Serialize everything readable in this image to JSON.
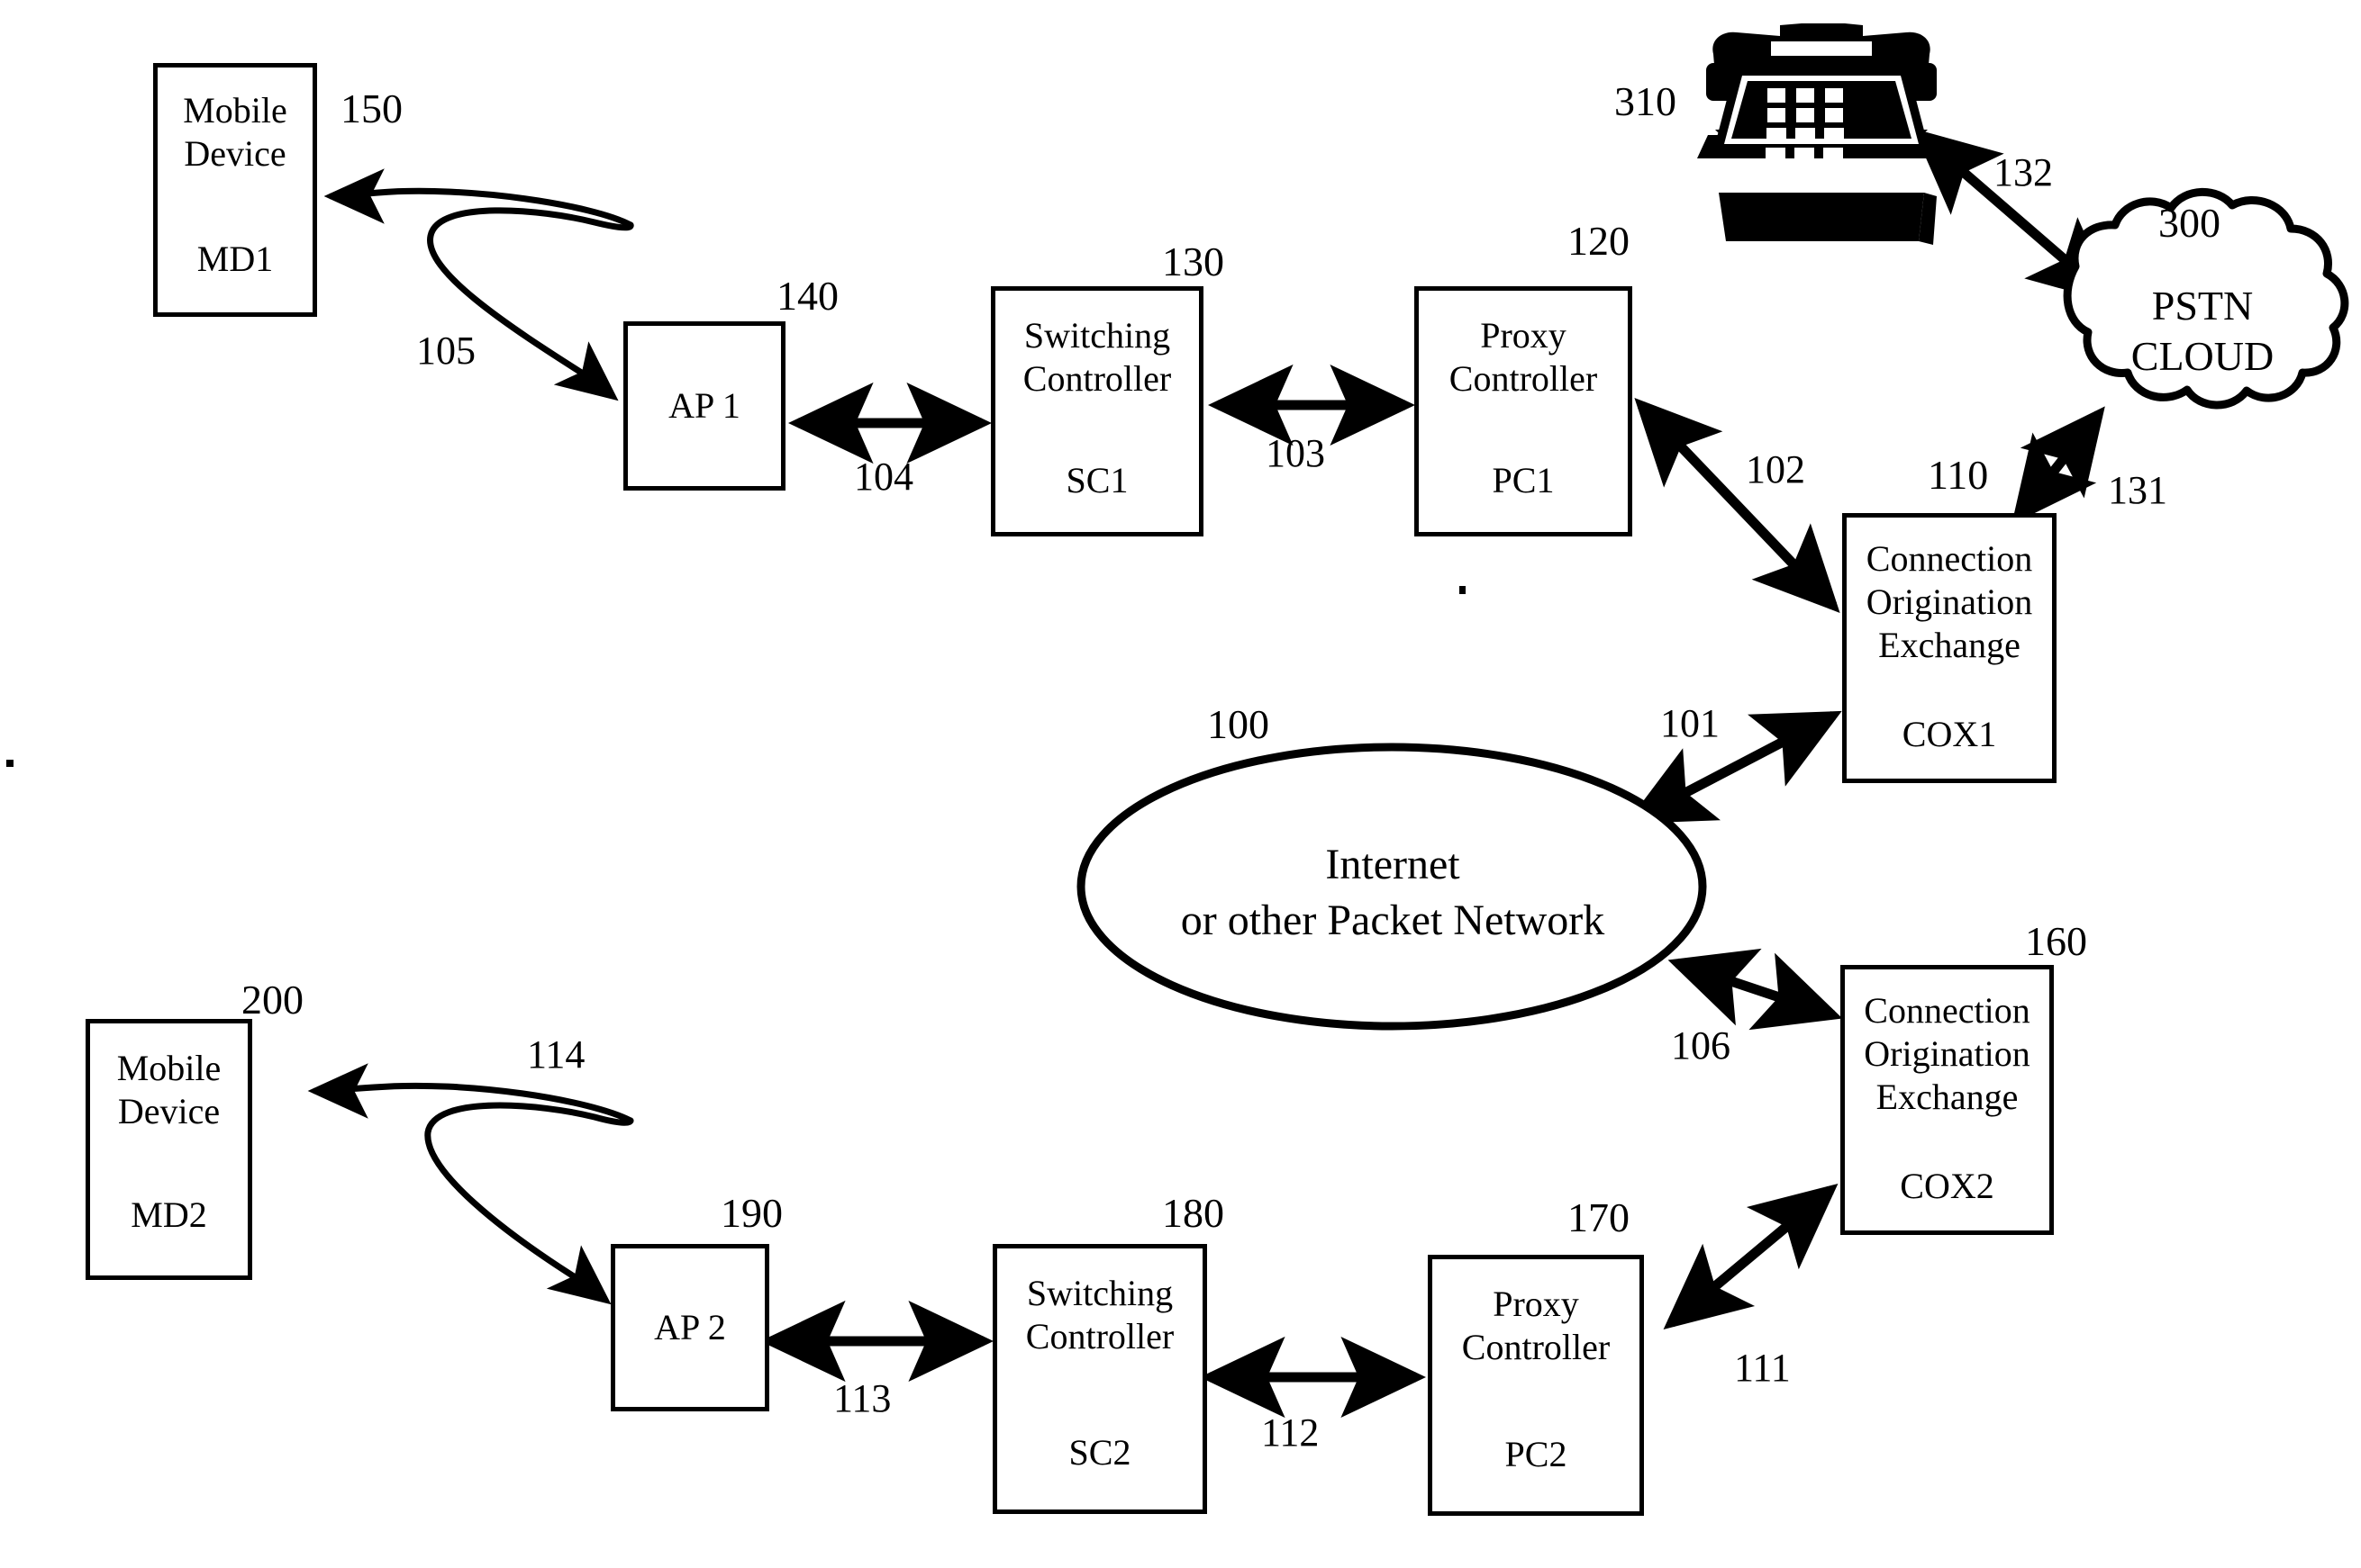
{
  "figure": {
    "type": "patent-network-diagram",
    "background_color": "#ffffff",
    "line_color": "#000000"
  },
  "nodes": [
    {
      "key": "md1",
      "title": "Mobile\nDevice",
      "id_label": "MD1",
      "ref": "150"
    },
    {
      "key": "ap1",
      "title": "AP 1",
      "id_label": "",
      "ref": "140"
    },
    {
      "key": "sc1",
      "title": "Switching\nController",
      "id_label": "SC1",
      "ref": "130"
    },
    {
      "key": "pc1",
      "title": "Proxy\nController",
      "id_label": "PC1",
      "ref": "120"
    },
    {
      "key": "cox1",
      "title": "Connection\nOrigination\nExchange",
      "id_label": "COX1",
      "ref": "110"
    },
    {
      "key": "md2",
      "title": "Mobile\nDevice",
      "id_label": "MD2",
      "ref": "200"
    },
    {
      "key": "ap2",
      "title": "AP 2",
      "id_label": "",
      "ref": "190"
    },
    {
      "key": "sc2",
      "title": "Switching\nController",
      "id_label": "SC2",
      "ref": "180"
    },
    {
      "key": "pc2",
      "title": "Proxy\nController",
      "id_label": "PC2",
      "ref": "170"
    },
    {
      "key": "cox2",
      "title": "Connection\nOrigination\nExchange",
      "id_label": "COX2",
      "ref": "160"
    }
  ],
  "cloud": {
    "label": "PSTN\nCLOUD",
    "ref": "300"
  },
  "internet": {
    "label": "Internet\nor other Packet Network",
    "ref": "100"
  },
  "telephone": {
    "icon": "desk-telephone-icon",
    "ref": "310"
  },
  "links": [
    {
      "key": "l105",
      "label": "105",
      "from": "ap1",
      "to": "md1",
      "style": "wireless-squiggle",
      "arrow": "single"
    },
    {
      "key": "l104",
      "label": "104",
      "from": "ap1",
      "to": "sc1",
      "style": "straight",
      "arrow": "double"
    },
    {
      "key": "l103",
      "label": "103",
      "from": "sc1",
      "to": "pc1",
      "style": "straight",
      "arrow": "double"
    },
    {
      "key": "l102",
      "label": "102",
      "from": "pc1",
      "to": "cox1",
      "style": "straight",
      "arrow": "double"
    },
    {
      "key": "l101",
      "label": "101",
      "from": "internet",
      "to": "cox1",
      "style": "straight",
      "arrow": "double"
    },
    {
      "key": "l131",
      "label": "131",
      "from": "cox1",
      "to": "cloud",
      "style": "straight",
      "arrow": "double"
    },
    {
      "key": "l132",
      "label": "132",
      "from": "cloud",
      "to": "telephone",
      "style": "straight",
      "arrow": "double"
    },
    {
      "key": "l106",
      "label": "106",
      "from": "internet",
      "to": "cox2",
      "style": "straight",
      "arrow": "double"
    },
    {
      "key": "l111",
      "label": "111",
      "from": "pc2",
      "to": "cox2",
      "style": "straight",
      "arrow": "double"
    },
    {
      "key": "l112",
      "label": "112",
      "from": "sc2",
      "to": "pc2",
      "style": "straight",
      "arrow": "double"
    },
    {
      "key": "l113",
      "label": "113",
      "from": "ap2",
      "to": "sc2",
      "style": "straight",
      "arrow": "double"
    },
    {
      "key": "l114",
      "label": "114",
      "from": "ap2",
      "to": "md2",
      "style": "wireless-squiggle",
      "arrow": "single"
    }
  ]
}
